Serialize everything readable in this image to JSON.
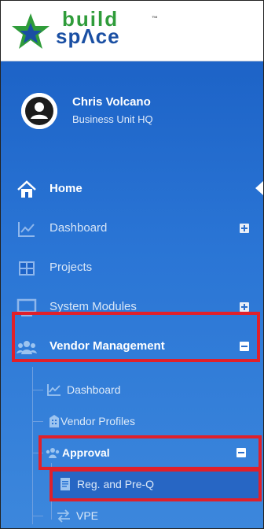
{
  "logo": {
    "line1": "build",
    "line2": "spΛce",
    "tm": "™"
  },
  "user": {
    "name": "Chris Volcano",
    "unit": "Business Unit HQ"
  },
  "menu": {
    "home": "Home",
    "dashboard": "Dashboard",
    "projects": "Projects",
    "system_modules": "System Modules",
    "vendor_management": "Vendor Management"
  },
  "vendor_sub": {
    "dashboard": "Dashboard",
    "vendor_profiles": "Vendor Profiles",
    "approval": "Approval",
    "reg_preq": "Reg. and Pre-Q",
    "vpe": "VPE"
  },
  "colors": {
    "accent": "#1d63c7",
    "highlight": "#e0202a",
    "logo_green": "#2f9c3a",
    "logo_blue": "#1a4fa3"
  }
}
